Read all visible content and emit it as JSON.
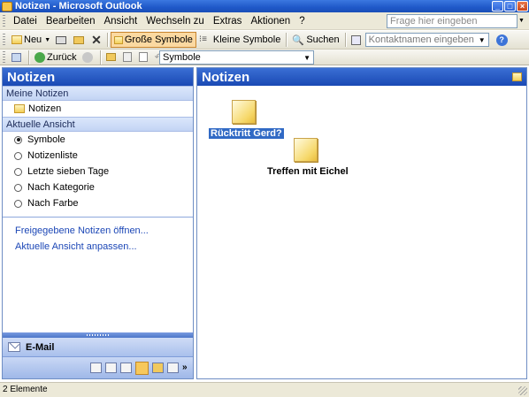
{
  "window": {
    "title": "Notizen - Microsoft Outlook"
  },
  "menu": {
    "items": [
      "Datei",
      "Bearbeiten",
      "Ansicht",
      "Wechseln zu",
      "Extras",
      "Aktionen",
      "?"
    ],
    "ask_placeholder": "Frage hier eingeben"
  },
  "toolbar": {
    "new_label": "Neu",
    "large_icons_label": "Große Symbole",
    "small_icons_label": "Kleine Symbole",
    "search_label": "Suchen",
    "contact_placeholder": "Kontaktnamen eingeben"
  },
  "toolbar2": {
    "back_label": "Zurück",
    "view_select_value": "Symbole"
  },
  "nav": {
    "header": "Notizen",
    "my_notes_section": "Meine Notizen",
    "notes_folder": "Notizen",
    "current_view_section": "Aktuelle Ansicht",
    "views": [
      "Symbole",
      "Notizenliste",
      "Letzte sieben Tage",
      "Nach Kategorie",
      "Nach Farbe"
    ],
    "selected_view": "Symbole",
    "links": [
      "Freigegebene Notizen öffnen...",
      "Aktuelle Ansicht anpassen..."
    ],
    "mail_button": "E-Mail"
  },
  "content": {
    "header": "Notizen",
    "notes": [
      {
        "label": "Rücktritt Gerd?",
        "selected": true
      },
      {
        "label": "Treffen mit Eichel",
        "selected": false
      }
    ]
  },
  "status": {
    "text": "2 Elemente"
  },
  "colors": {
    "accent": "#1a49b4",
    "selection": "#316ac5",
    "note": "#f6d86a"
  }
}
